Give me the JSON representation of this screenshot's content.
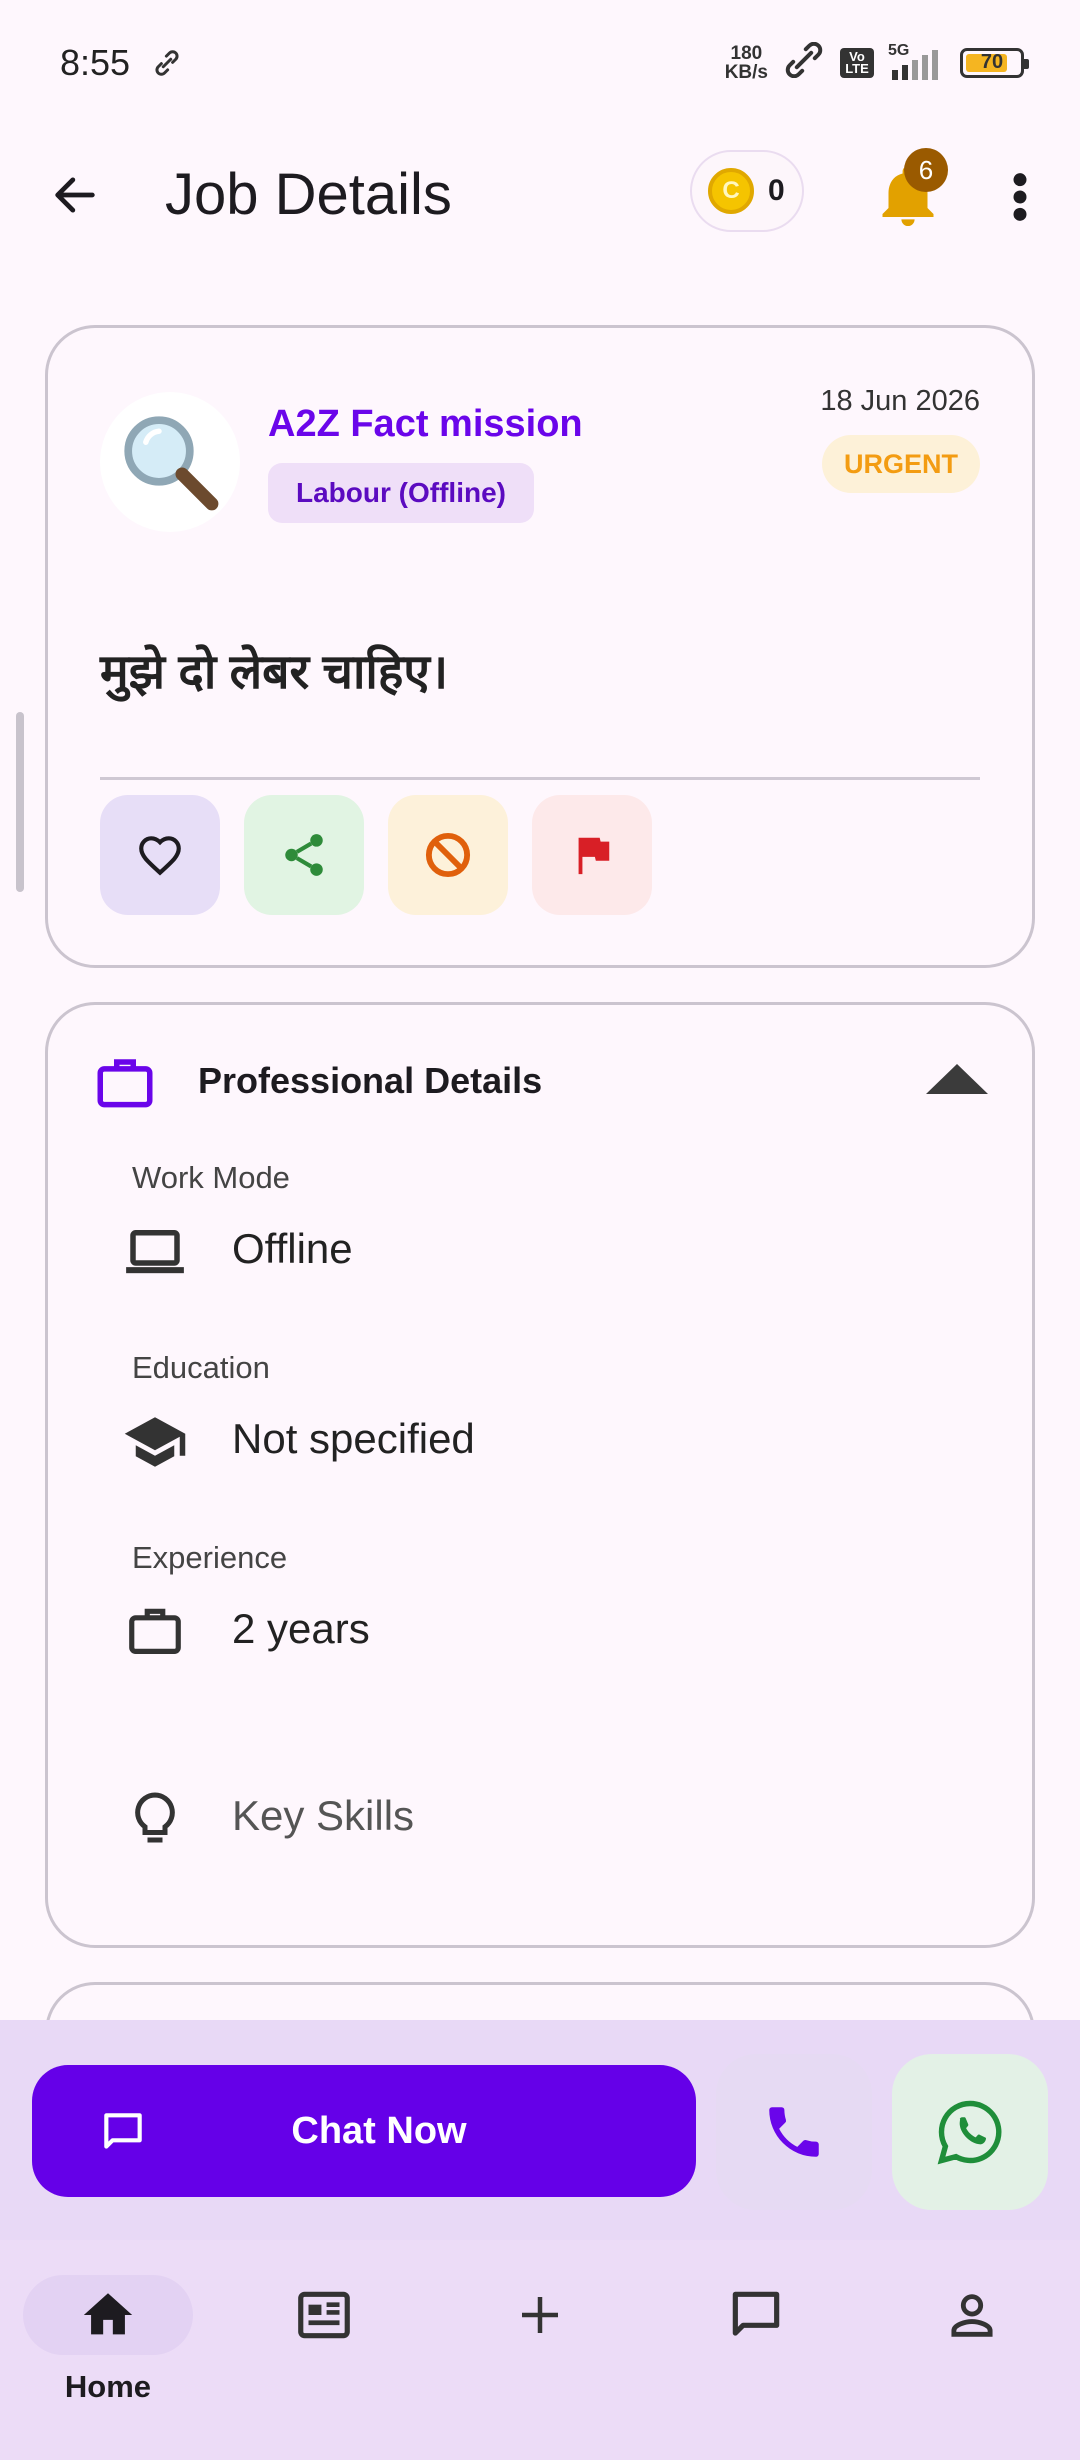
{
  "status_bar": {
    "time": "8:55",
    "net_speed_value": "180",
    "net_speed_unit": "KB/s",
    "volte": "Vo LTE",
    "network": "5G",
    "battery": "70"
  },
  "app_bar": {
    "title": "Job Details",
    "coins": "0",
    "notification_count": "6"
  },
  "job": {
    "company": "A2Z Fact mission",
    "category": "Labour (Offline)",
    "date": "18 Jun 2026",
    "urgency": "URGENT",
    "title": "मुझे दो लेबर चाहिए।"
  },
  "professional": {
    "title": "Professional Details",
    "work_mode_label": "Work Mode",
    "work_mode_value": "Offline",
    "education_label": "Education",
    "education_value": "Not specified",
    "experience_label": "Experience",
    "experience_value": "2 years",
    "skills_label": "Key Skills"
  },
  "actions": {
    "chat_label": "Chat Now"
  },
  "bottom_nav": {
    "home_label": "Home"
  },
  "colors": {
    "primary": "#6500e8",
    "urgent": "#f39c12",
    "background": "#fef7fd"
  }
}
